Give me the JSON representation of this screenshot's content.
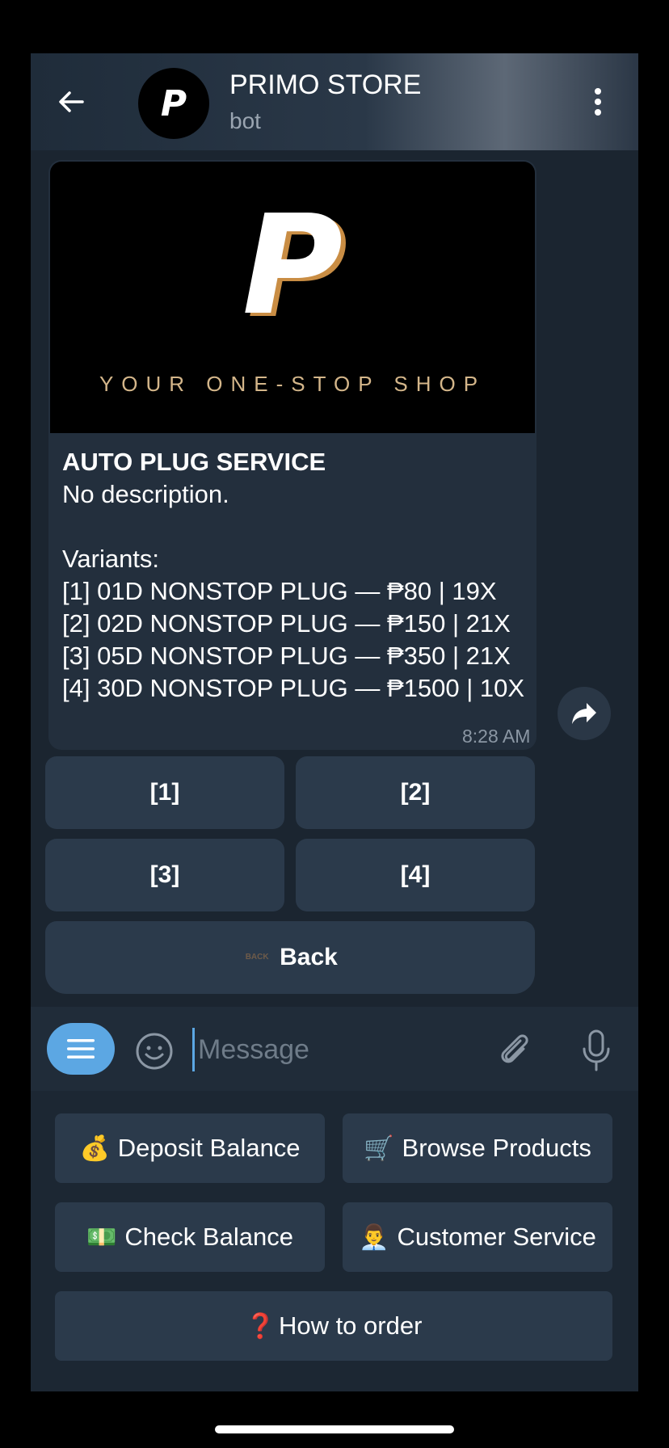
{
  "header": {
    "title": "PRIMO STORE",
    "subtitle": "bot",
    "avatar_letter": "P"
  },
  "message": {
    "banner_letter": "P",
    "banner_tagline": "YOUR ONE-STOP SHOP",
    "title": "AUTO PLUG SERVICE",
    "body": "No description.\n\nVariants:\n[1] 01D NONSTOP PLUG — ₱80 | 19X\n[2] 02D NONSTOP PLUG — ₱150 | 21X\n[3] 05D NONSTOP PLUG — ₱350 | 21X\n[4] 30D NONSTOP PLUG — ₱1500 | 10X",
    "time": "8:28 AM"
  },
  "inline_keyboard": {
    "btn1": "[1]",
    "btn2": "[2]",
    "btn3": "[3]",
    "btn4": "[4]",
    "back_icon_text": "BACK",
    "back": "Back"
  },
  "input": {
    "placeholder": "Message"
  },
  "reply_keyboard": {
    "deposit": {
      "emoji": "💰",
      "label": "Deposit Balance"
    },
    "browse": {
      "emoji": "🛒",
      "label": "Browse Products"
    },
    "check": {
      "emoji": "💵",
      "label": "Check Balance"
    },
    "service": {
      "emoji": "👨‍💼",
      "label": "Customer Service"
    },
    "howto": {
      "emoji": "❓",
      "label": "How to order"
    }
  },
  "colors": {
    "accent": "#5ca7e3",
    "bubble": "#232f3d",
    "button": "#2b3a4b"
  }
}
